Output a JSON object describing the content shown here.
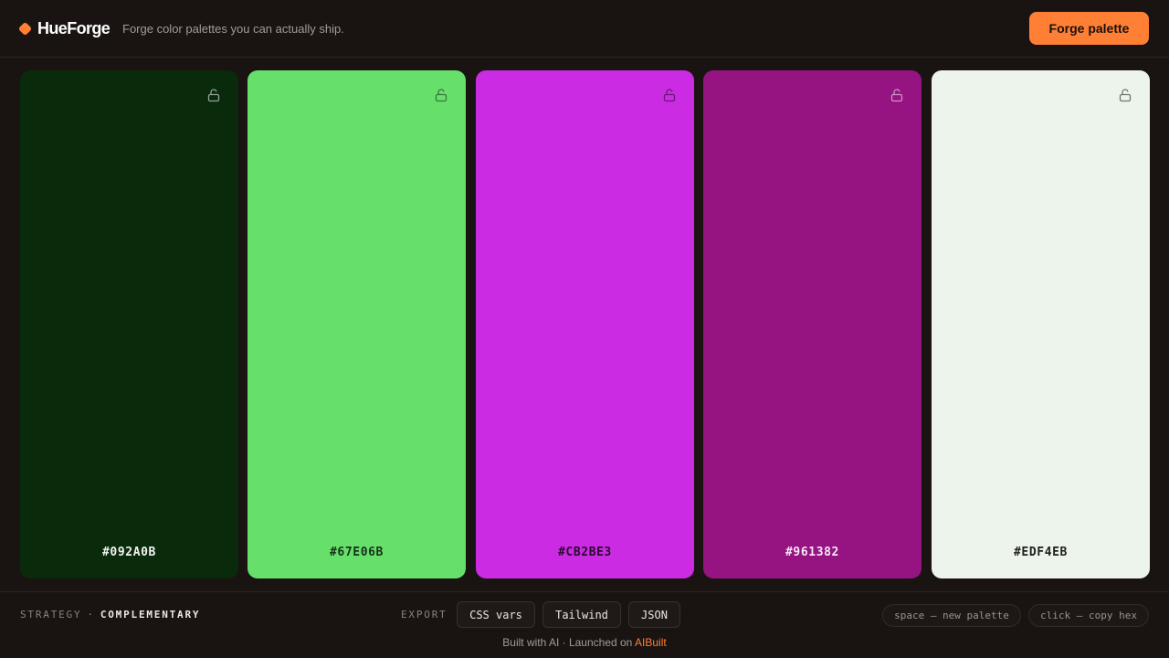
{
  "header": {
    "brand": "HueForge",
    "tagline": "Forge color palettes you can actually ship.",
    "forge_button": "Forge palette",
    "accent": "#FF7F35"
  },
  "palette": [
    {
      "hex": "#092A0B",
      "color": "#092A0B",
      "text_color": "#F2F2F2",
      "locked": false,
      "lock_icon": "unlock-icon"
    },
    {
      "hex": "#67E06B",
      "color": "#67E06B",
      "text_color": "#16301A",
      "locked": false,
      "lock_icon": "unlock-icon"
    },
    {
      "hex": "#CB2BE3",
      "color": "#CB2BE3",
      "text_color": "#2A0A30",
      "locked": false,
      "lock_icon": "unlock-icon"
    },
    {
      "hex": "#961382",
      "color": "#961382",
      "text_color": "#F6E8F3",
      "locked": false,
      "lock_icon": "unlock-icon"
    },
    {
      "hex": "#EDF4EB",
      "color": "#EDF4EB",
      "text_color": "#1E221D",
      "locked": false,
      "lock_icon": "unlock-icon"
    }
  ],
  "footer": {
    "strategy_label": "STRATEGY",
    "strategy_sep": "·",
    "strategy_value": "COMPLEMENTARY",
    "export_label": "EXPORT",
    "export_buttons": [
      "CSS vars",
      "Tailwind",
      "JSON"
    ],
    "hints": [
      "space — new palette",
      "click — copy hex"
    ],
    "credit_text": "Built with AI · Launched on",
    "credit_link": "AIBuilt"
  }
}
